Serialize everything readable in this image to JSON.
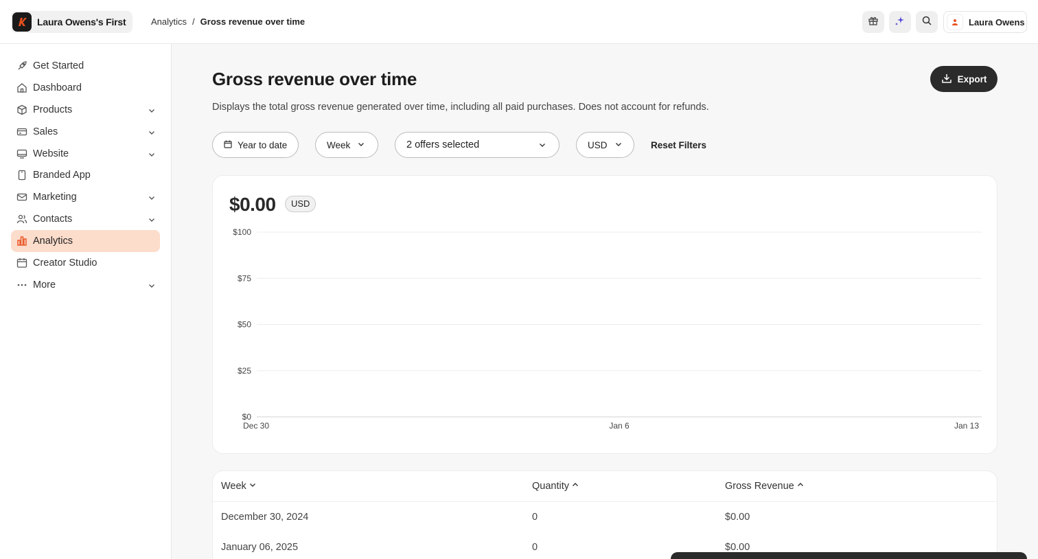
{
  "header": {
    "brand_name": "Laura Owens's First",
    "breadcrumb": [
      "Analytics",
      "/",
      "Gross revenue over time"
    ],
    "user_name": "Laura Owens",
    "icons": [
      "gift-icon",
      "sparkle-icon",
      "search-icon"
    ]
  },
  "sidebar": {
    "items": [
      {
        "label": "Get Started",
        "icon": "rocket-icon",
        "expandable": false
      },
      {
        "label": "Dashboard",
        "icon": "home-icon",
        "expandable": false
      },
      {
        "label": "Products",
        "icon": "box-icon",
        "expandable": true
      },
      {
        "label": "Sales",
        "icon": "credit-card-icon",
        "expandable": true
      },
      {
        "label": "Website",
        "icon": "monitor-icon",
        "expandable": true
      },
      {
        "label": "Branded App",
        "icon": "phone-icon",
        "expandable": false
      },
      {
        "label": "Marketing",
        "icon": "mail-icon",
        "expandable": true
      },
      {
        "label": "Contacts",
        "icon": "users-icon",
        "expandable": true
      },
      {
        "label": "Analytics",
        "icon": "bar-chart-icon",
        "expandable": false,
        "active": true
      },
      {
        "label": "Creator Studio",
        "icon": "calendar-icon",
        "expandable": false
      },
      {
        "label": "More",
        "icon": "dots-icon",
        "expandable": true
      }
    ]
  },
  "page": {
    "title": "Gross revenue over time",
    "description": "Displays the total gross revenue generated over time, including all paid purchases. Does not account for refunds.",
    "export_label": "Export"
  },
  "filters": {
    "date_range": "Year to date",
    "interval": "Week",
    "offers": "2 offers selected",
    "currency": "USD",
    "reset_label": "Reset Filters"
  },
  "summary": {
    "total": "$0.00",
    "currency": "USD"
  },
  "chart_data": {
    "type": "line",
    "x": [
      "Dec 30",
      "Jan 6",
      "Jan 13"
    ],
    "series": [
      {
        "values": [
          0,
          0,
          0
        ]
      }
    ],
    "yticks": [
      "$0",
      "$25",
      "$50",
      "$75",
      "$100"
    ],
    "ylim": [
      0,
      100
    ],
    "grid": true,
    "accent_color": "#e8501f"
  },
  "table": {
    "columns": [
      "Week",
      "Quantity",
      "Gross Revenue"
    ],
    "rows": [
      [
        "December 30, 2024",
        "0",
        "$0.00"
      ],
      [
        "January 06, 2025",
        "0",
        "$0.00"
      ]
    ]
  }
}
